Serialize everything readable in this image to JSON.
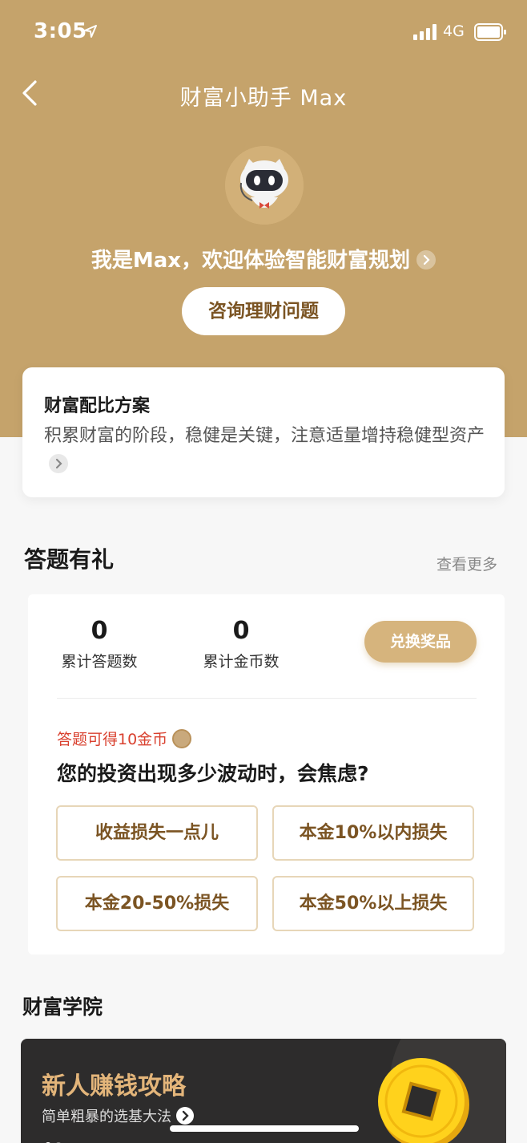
{
  "status_bar": {
    "time": "3:05",
    "network": "4G"
  },
  "nav": {
    "title": "财富小助手 Max"
  },
  "hero": {
    "greeting": "我是Max，欢迎体验智能财富规划",
    "consult_button": "咨询理财问题"
  },
  "plan_card": {
    "title": "财富配比方案",
    "description": "积累财富的阶段，稳健是关键，注意适量增持稳健型资产"
  },
  "quiz_section": {
    "title": "答题有礼",
    "see_more": "查看更多",
    "stats": [
      {
        "value": "0",
        "label": "累计答题数"
      },
      {
        "value": "0",
        "label": "累计金币数"
      }
    ],
    "redeem_button": "兑换奖品",
    "reward_text": "答题可得10金币",
    "question": "您的投资出现多少波动时，会焦虑?",
    "options": [
      "收益损失一点儿",
      "本金10%以内损失",
      "本金20-50%损失",
      "本金50%以上损失"
    ]
  },
  "academy_section": {
    "title": "财富学院",
    "banner_title": "新人赚钱攻略",
    "banner_subtitle": "简单粗暴的选基大法"
  },
  "colors": {
    "brand_gold": "#c5a36b",
    "button_gold": "#d6b47d",
    "text_brown": "#7b5423",
    "reward_red": "#d9412f"
  }
}
